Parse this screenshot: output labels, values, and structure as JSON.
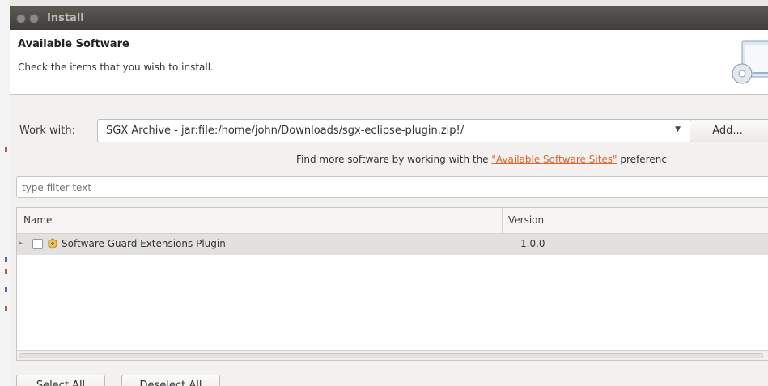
{
  "window": {
    "title": "Install"
  },
  "header": {
    "title": "Available Software",
    "subtitle": "Check the items that you wish to install.",
    "icon": "software-install-icon"
  },
  "work_with": {
    "label": "Work with:",
    "value": "SGX Archive - jar:file:/home/john/Downloads/sgx-eclipse-plugin.zip!/",
    "add_label": "Add..."
  },
  "more_software": {
    "prefix": "Find more software by working with the ",
    "link": "\"Available Software Sites\"",
    "suffix": " preferenc"
  },
  "filter": {
    "placeholder": "type filter text"
  },
  "table": {
    "columns": [
      "Name",
      "Version"
    ],
    "rows": [
      {
        "name": "Software Guard Extensions Plugin",
        "version": "1.0.0",
        "checked": false
      }
    ]
  },
  "buttons": {
    "select_all": "Select All",
    "deselect_all": "Deselect All"
  },
  "colors": {
    "link": "#e0622e",
    "titlebar": "#4a4945"
  }
}
